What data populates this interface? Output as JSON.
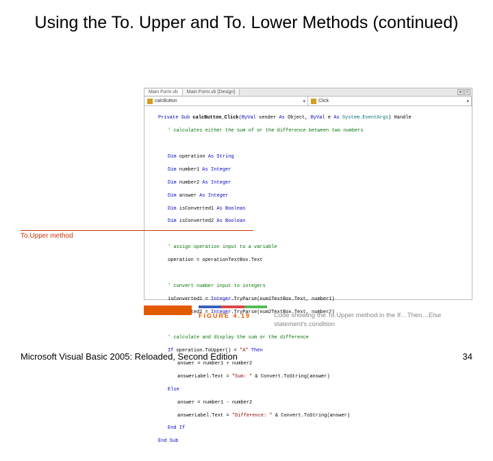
{
  "title": "Using the To. Upper and To. Lower Methods (continued)",
  "footer_left": "Microsoft Visual Basic 2005: Reloaded, Second Edition",
  "footer_right": "34",
  "callout": "To.Upper method",
  "ide": {
    "tab1": "Main Form.vb",
    "tab2": "Main Form.vb [Design]",
    "dd_left": "calcButton",
    "dd_right": "Click"
  },
  "code": {
    "l01a": "Private Sub",
    "l01b": "calcButton_Click",
    "l01c": "(",
    "l01d": "ByVal",
    "l01e": " sender ",
    "l01f": "As",
    "l01g": " Object, ",
    "l01h": "ByVal",
    "l01i": " e ",
    "l01j": "As",
    "l01k": " System.EventArgs",
    "l01l": ") Handle",
    "l02": "' calculates either the sum of or the difference between two numbers",
    "l03a": "Dim",
    "l03b": " operation ",
    "l03c": "As String",
    "l04a": "Dim",
    "l04b": " number1 ",
    "l04c": "As Integer",
    "l05a": "Dim",
    "l05b": " number2 ",
    "l05c": "As Integer",
    "l06a": "Dim",
    "l06b": " answer ",
    "l06c": "As Integer",
    "l07a": "Dim",
    "l07b": " isConverted1 ",
    "l07c": "As Boolean",
    "l08a": "Dim",
    "l08b": " isConverted2 ",
    "l08c": "As Boolean",
    "l09": "' assign operation input to a variable",
    "l10": "operation = operationTextBox.Text",
    "l11": "' convert number input to integers",
    "l12a": "isConverted1 = ",
    "l12b": "Integer",
    "l12c": ".TryParse(num1TextBox.Text, number1)",
    "l13a": "isConverted2 = ",
    "l13b": "Integer",
    "l13c": ".TryParse(num2TextBox.Text, number2)",
    "l14": "' calculate and display the sum or the difference",
    "l15a": "If",
    "l15b": " operation.ToUpper() = ",
    "l15c": "\"A\"",
    "l15d": "Then",
    "l16": "answer = number1 + number2",
    "l17a": "answerLabel.Text = ",
    "l17b": "\"Sum: \"",
    "l17c": " & Convert.ToString(answer)",
    "l18": "Else",
    "l19": "answer = number1 - number2",
    "l20a": "answerLabel.Text = ",
    "l20b": "\"Difference: \"",
    "l20c": " & Convert.ToString(answer)",
    "l21": "End If",
    "l22": "End Sub"
  },
  "caption": {
    "fig_label": "FIGURE 4.19",
    "text": "Code showing the To.Upper method in the If…Then…Else statement's condition"
  }
}
